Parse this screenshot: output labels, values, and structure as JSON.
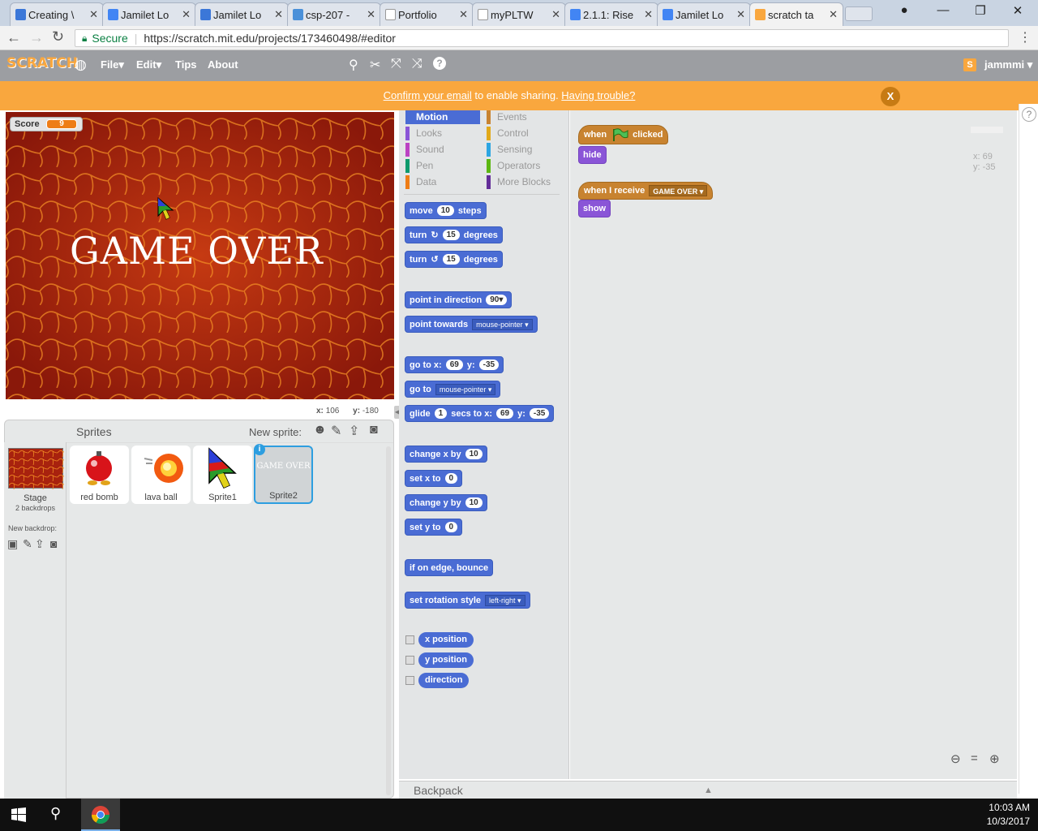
{
  "browser": {
    "tabs": [
      {
        "title": "Creating \\",
        "color": "#3b77d8"
      },
      {
        "title": "Jamilet Lo",
        "color": "#4285f4"
      },
      {
        "title": "Jamilet Lo",
        "color": "#3b77d8"
      },
      {
        "title": "csp-207 -",
        "color": "#4a90d9"
      },
      {
        "title": "Portfolio",
        "color": "#999999"
      },
      {
        "title": "myPLTW",
        "color": "#999999"
      },
      {
        "title": "2.1.1: Rise",
        "color": "#4285f4"
      },
      {
        "title": "Jamilet Lo",
        "color": "#4285f4"
      },
      {
        "title": "scratch ta",
        "color": "#f9a73e"
      }
    ],
    "secure_label": "Secure",
    "url": "https://scratch.mit.edu/projects/173460498/#editor"
  },
  "scratch_menu": {
    "logo": "SCRATCH",
    "file": "File",
    "edit": "Edit",
    "tips": "Tips",
    "about": "About",
    "username": "jammmi"
  },
  "banner": {
    "confirm_link": "Confirm your email",
    "middle": " to enable sharing. ",
    "trouble_link": "Having trouble?",
    "close": "X"
  },
  "stage": {
    "score_label": "Score",
    "score_value": "9",
    "game_over": "GAME OVER",
    "x_label": "x:",
    "x_value": "106",
    "y_label": "y:",
    "y_value": "-180"
  },
  "sprites_pane": {
    "title": "Sprites",
    "new_sprite": "New sprite:",
    "stage_label": "Stage",
    "backdrops": "2 backdrops",
    "new_backdrop": "New backdrop:",
    "sprites": [
      "red bomb",
      "lava ball",
      "Sprite1",
      "Sprite2"
    ],
    "sprite2_thumb_text": "GAME OVER"
  },
  "categories": {
    "motion": "Motion",
    "looks": "Looks",
    "sound": "Sound",
    "pen": "Pen",
    "data": "Data",
    "events": "Events",
    "control": "Control",
    "sensing": "Sensing",
    "operators": "Operators",
    "more": "More Blocks"
  },
  "blocks": {
    "move": "move",
    "move_n": "10",
    "steps": "steps",
    "turn": "turn",
    "turn_n1": "15",
    "turn_n2": "15",
    "degrees": "degrees",
    "point_dir": "point in direction",
    "point_dir_n": "90▾",
    "point_towards": "point towards",
    "mouse_pointer": "mouse-pointer",
    "goto": "go to x:",
    "goto_x": "69",
    "y": "y:",
    "goto_y": "-35",
    "goto2": "go to",
    "glide": "glide",
    "glide_n": "1",
    "secs_to_x": "secs to x:",
    "glide_x": "69",
    "glide_y": "-35",
    "change_x": "change x by",
    "change_x_n": "10",
    "set_x": "set x to",
    "set_x_n": "0",
    "change_y": "change y by",
    "change_y_n": "10",
    "set_y": "set y to",
    "set_y_n": "0",
    "bounce": "if on edge, bounce",
    "rot_style": "set rotation style",
    "left_right": "left-right",
    "xpos": "x position",
    "ypos": "y position",
    "direction": "direction"
  },
  "scripts": {
    "when": "when",
    "clicked": "clicked",
    "hide": "hide",
    "when_receive": "when I receive",
    "game_over_msg": "GAME OVER",
    "show": "show",
    "coord_x": "x: 69",
    "coord_y": "y: -35"
  },
  "backpack": "Backpack",
  "taskbar": {
    "time": "10:03 AM",
    "date": "10/3/2017"
  }
}
